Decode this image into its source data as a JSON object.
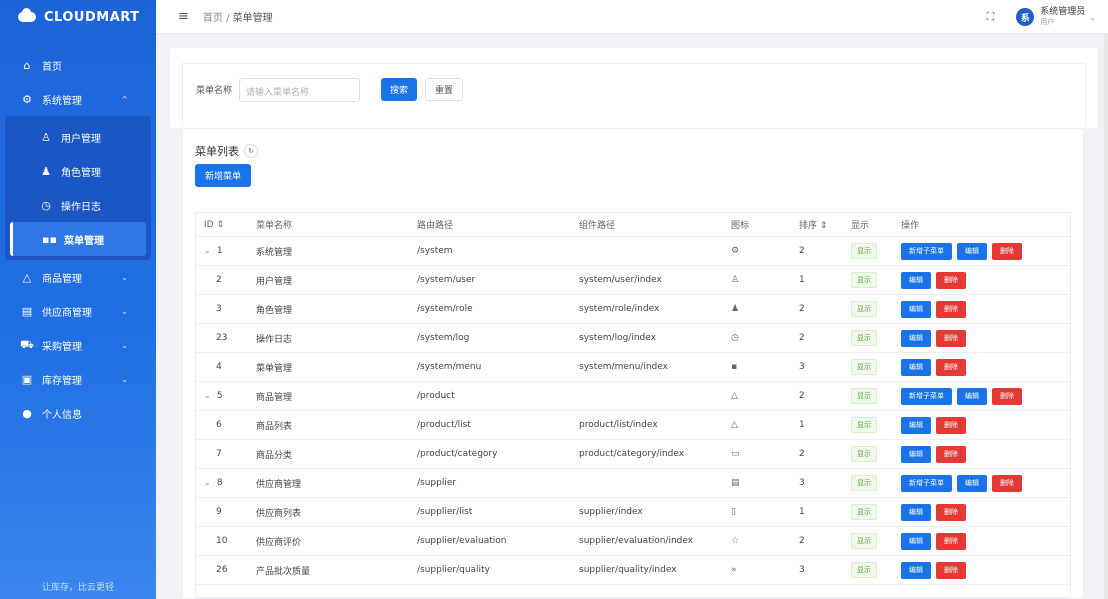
{
  "app": {
    "name": "CLOUDMART",
    "footer": "让库存，比云更轻"
  },
  "sidebar": {
    "items": [
      {
        "label": "首页",
        "icon": "home-icon",
        "glyph": "⌂"
      },
      {
        "label": "系统管理",
        "icon": "gear-icon",
        "glyph": "⚙",
        "chev": "^"
      },
      {
        "label": "用户管理",
        "icon": "user-outline-icon",
        "glyph": "♙"
      },
      {
        "label": "角色管理",
        "icon": "user-solid-icon",
        "glyph": "♟"
      },
      {
        "label": "操作日志",
        "icon": "stopwatch-icon",
        "glyph": "◷"
      },
      {
        "label": "菜单管理",
        "icon": "grid-icon",
        "glyph": "▪▪"
      },
      {
        "label": "商品管理",
        "icon": "bag-icon",
        "glyph": "△",
        "chev": "⌄"
      },
      {
        "label": "供应商管理",
        "icon": "building-icon",
        "glyph": "▤",
        "chev": "⌄"
      },
      {
        "label": "采购管理",
        "icon": "cart-icon",
        "glyph": "⛟",
        "chev": "⌄"
      },
      {
        "label": "库存管理",
        "icon": "warehouse-icon",
        "glyph": "▣",
        "chev": "⌄"
      },
      {
        "label": "个人信息",
        "icon": "person-icon",
        "glyph": "●"
      }
    ]
  },
  "header": {
    "breadcrumb_home": "首页",
    "breadcrumb_sep": "/",
    "breadcrumb_current": "菜单管理",
    "user_name": "系统管理员",
    "user_role": "用户",
    "avatar_text": "系"
  },
  "search": {
    "label": "菜单名称",
    "placeholder": "请输入菜单名称",
    "search_btn": "搜索",
    "reset_btn": "重置"
  },
  "list": {
    "title": "菜单列表",
    "add_btn": "新增菜单",
    "columns": [
      "ID",
      "菜单名称",
      "路由路径",
      "组件路径",
      "图标",
      "排序",
      "显示",
      "操作"
    ],
    "rows": [
      {
        "id": "1",
        "tree": "⌄",
        "name": "系统管理",
        "route": "/system",
        "comp": "",
        "icon": "⚙",
        "sort": "2",
        "show": "显示",
        "ops": [
          "新增子菜单",
          "编辑",
          "删除"
        ]
      },
      {
        "id": "2",
        "tree": "",
        "name": "用户管理",
        "route": "/system/user",
        "comp": "system/user/index",
        "icon": "♙",
        "sort": "1",
        "show": "显示",
        "ops": [
          "编辑",
          "删除"
        ]
      },
      {
        "id": "3",
        "tree": "",
        "name": "角色管理",
        "route": "/system/role",
        "comp": "system/role/index",
        "icon": "♟",
        "sort": "2",
        "show": "显示",
        "ops": [
          "编辑",
          "删除"
        ]
      },
      {
        "id": "23",
        "tree": "",
        "name": "操作日志",
        "route": "/system/log",
        "comp": "system/log/index",
        "icon": "◷",
        "sort": "2",
        "show": "显示",
        "ops": [
          "编辑",
          "删除"
        ]
      },
      {
        "id": "4",
        "tree": "",
        "name": "菜单管理",
        "route": "/system/menu",
        "comp": "system/menu/index",
        "icon": "▪",
        "sort": "3",
        "show": "显示",
        "ops": [
          "编辑",
          "删除"
        ]
      },
      {
        "id": "5",
        "tree": "⌄",
        "name": "商品管理",
        "route": "/product",
        "comp": "",
        "icon": "△",
        "sort": "2",
        "show": "显示",
        "ops": [
          "新增子菜单",
          "编辑",
          "删除"
        ]
      },
      {
        "id": "6",
        "tree": "",
        "name": "商品列表",
        "route": "/product/list",
        "comp": "product/list/index",
        "icon": "△",
        "sort": "1",
        "show": "显示",
        "ops": [
          "编辑",
          "删除"
        ]
      },
      {
        "id": "7",
        "tree": "",
        "name": "商品分类",
        "route": "/product/category",
        "comp": "product/category/index",
        "icon": "▭",
        "sort": "2",
        "show": "显示",
        "ops": [
          "编辑",
          "删除"
        ]
      },
      {
        "id": "8",
        "tree": "⌄",
        "name": "供应商管理",
        "route": "/supplier",
        "comp": "",
        "icon": "▤",
        "sort": "3",
        "show": "显示",
        "ops": [
          "新增子菜单",
          "编辑",
          "删除"
        ]
      },
      {
        "id": "9",
        "tree": "",
        "name": "供应商列表",
        "route": "/supplier/list",
        "comp": "supplier/index",
        "icon": "▯",
        "sort": "1",
        "show": "显示",
        "ops": [
          "编辑",
          "删除"
        ]
      },
      {
        "id": "10",
        "tree": "",
        "name": "供应商评价",
        "route": "/supplier/evaluation",
        "comp": "supplier/evaluation/index",
        "icon": "☆",
        "sort": "2",
        "show": "显示",
        "ops": [
          "编辑",
          "删除"
        ]
      },
      {
        "id": "26",
        "tree": "",
        "name": "产品批次质量",
        "route": "/supplier/quality",
        "comp": "supplier/quality/index",
        "icon": "»",
        "sort": "3",
        "show": "显示",
        "ops": [
          "编辑",
          "删除"
        ]
      }
    ]
  },
  "colors": {
    "primary": "#1a73e8",
    "danger": "#e53935",
    "sidebar": "#1f6fe3"
  }
}
